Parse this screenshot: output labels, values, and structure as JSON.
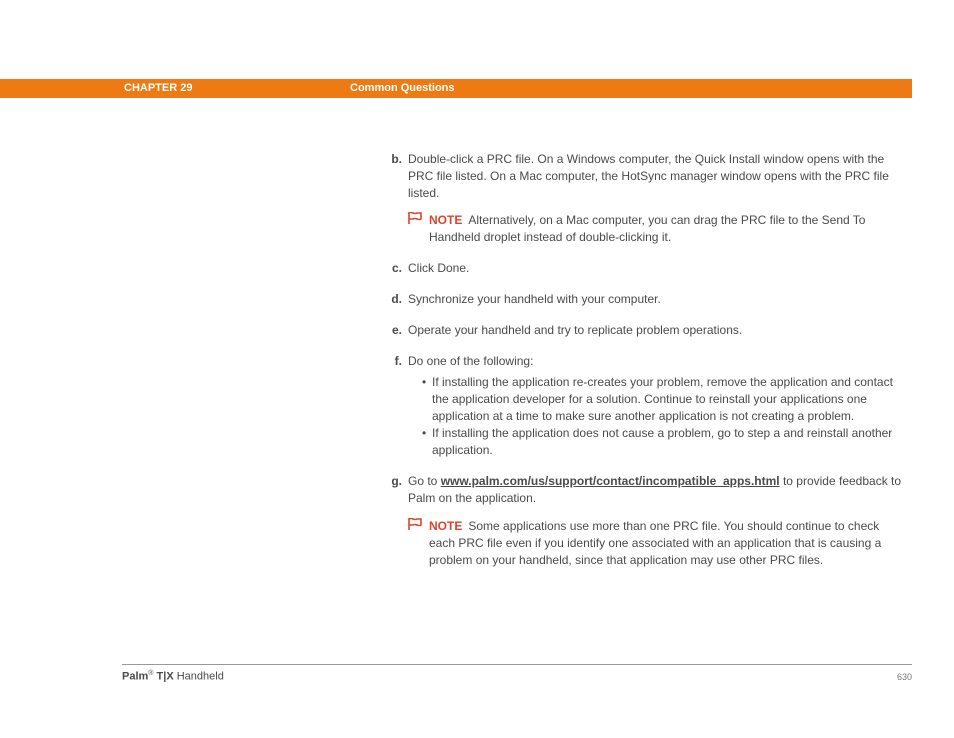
{
  "header": {
    "chapter": "CHAPTER 29",
    "title": "Common Questions"
  },
  "body": {
    "b": {
      "label": "b.",
      "text": "Double-click a PRC file. On a Windows computer, the Quick Install window opens with the PRC file listed. On a Mac computer, the HotSync manager window opens with the PRC file listed.",
      "note_label": "NOTE",
      "note_text": "Alternatively, on a Mac computer, you can drag the PRC file to the Send To Handheld droplet instead of double-clicking it."
    },
    "c": {
      "label": "c.",
      "text": "Click Done."
    },
    "d": {
      "label": "d.",
      "text": "Synchronize your handheld with your computer."
    },
    "e": {
      "label": "e.",
      "text": "Operate your handheld and try to replicate problem operations."
    },
    "f": {
      "label": "f.",
      "text": "Do one of the following:",
      "bullets": [
        "If installing the application re-creates your problem, remove the application and contact the application developer for a solution. Continue to reinstall your applications one application at a time to make sure another application is not creating a problem.",
        "If installing the application does not cause a problem, go to step a and reinstall another application."
      ]
    },
    "g": {
      "label": "g.",
      "pre": "Go to ",
      "link": "www.palm.com/us/support/contact/incompatible_apps.html",
      "post": " to provide feedback to Palm on the application.",
      "note_label": "NOTE",
      "note_text": "Some applications use more than one PRC file. You should continue to check each PRC file even if you identify one associated with an application that is causing a problem on your handheld, since that application may use other PRC files."
    }
  },
  "footer": {
    "brand_bold": "Palm",
    "reg": "®",
    "model_bold": " T|X",
    "rest": " Handheld",
    "page": "630"
  }
}
